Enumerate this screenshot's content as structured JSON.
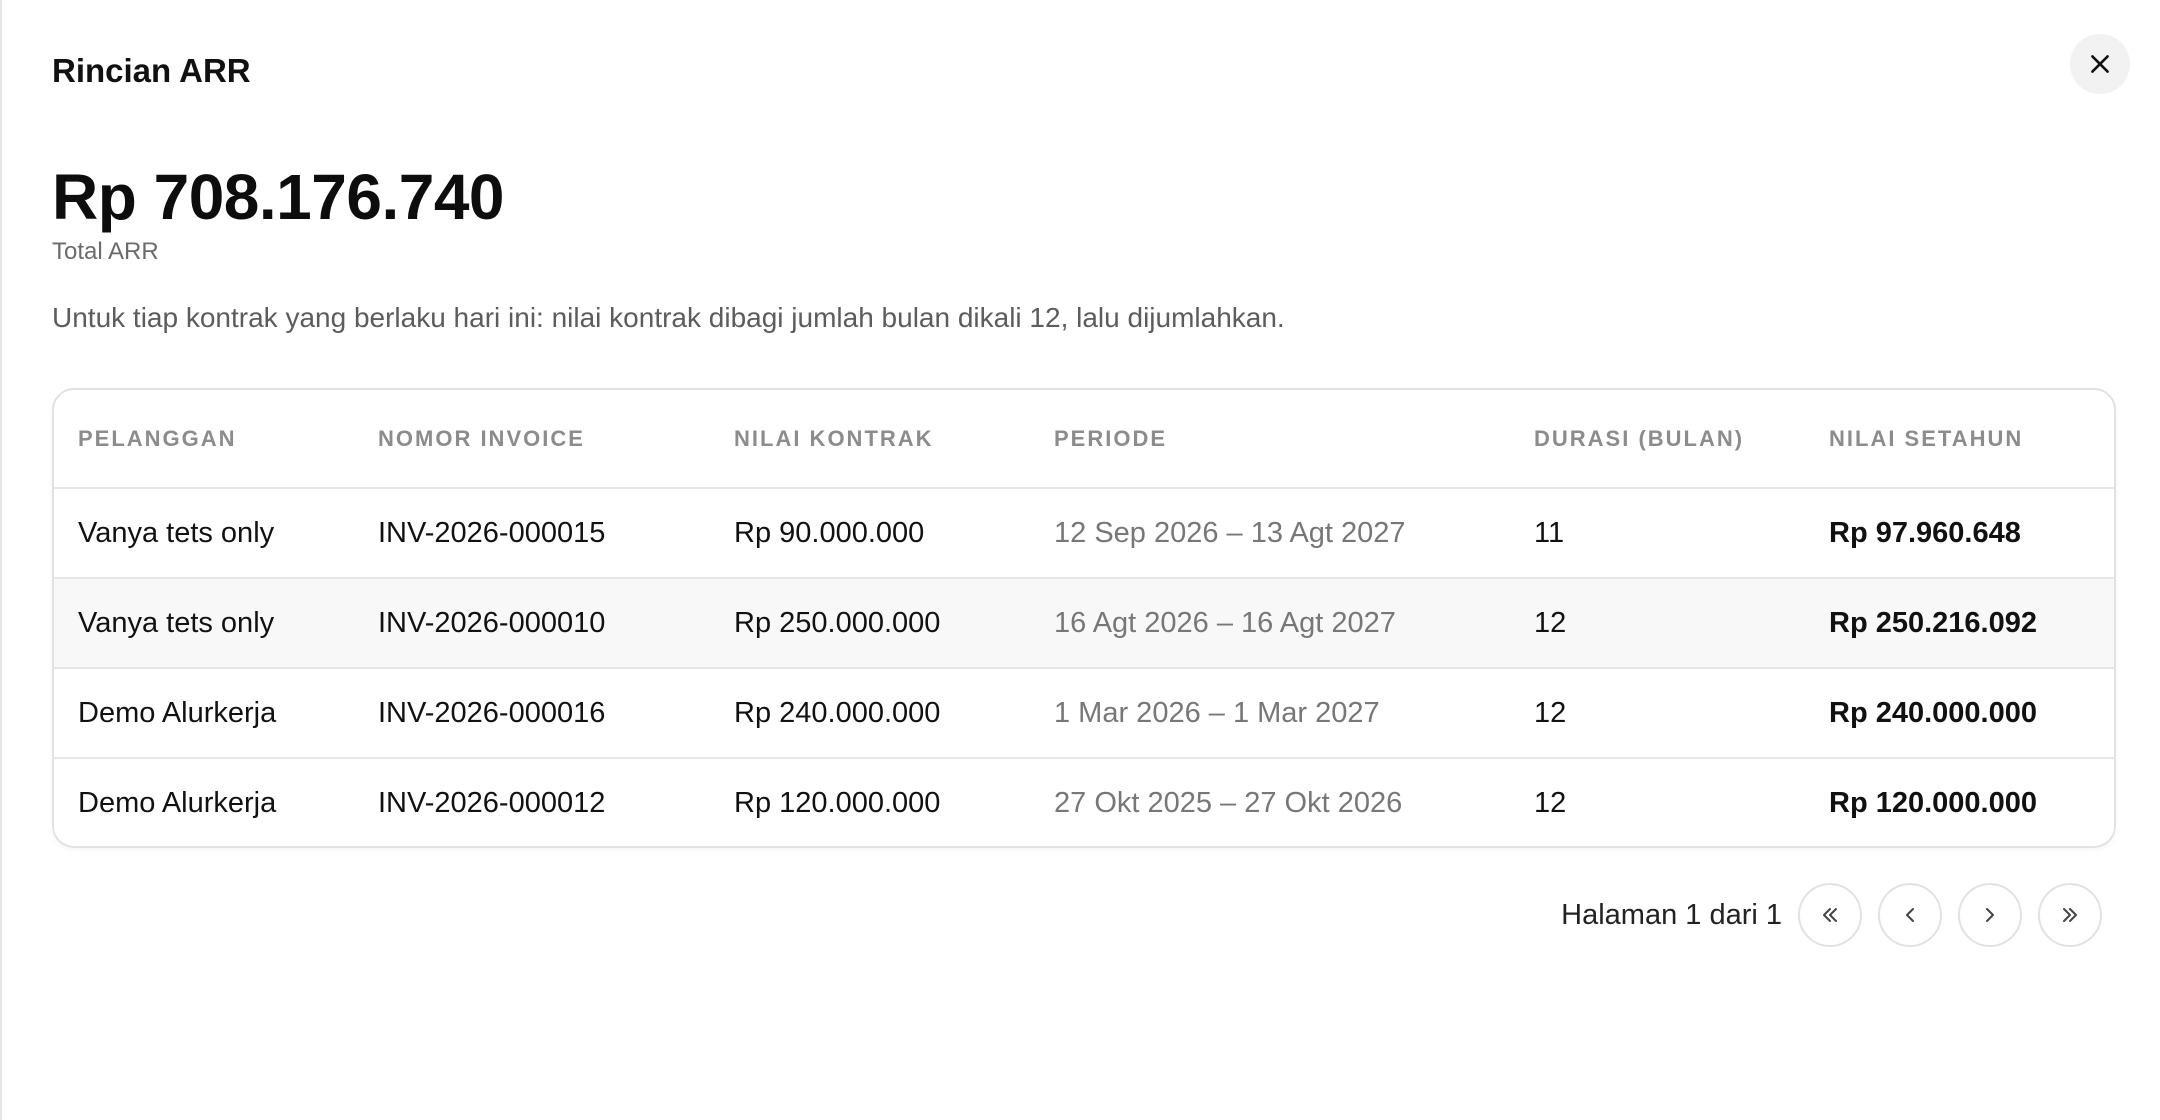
{
  "modal": {
    "title": "Rincian ARR",
    "total_value": "Rp 708.176.740",
    "total_label": "Total ARR",
    "description": "Untuk tiap kontrak yang berlaku hari ini: nilai kontrak dibagi jumlah bulan dikali 12, lalu dijumlahkan."
  },
  "table": {
    "headers": [
      "PELANGGAN",
      "NOMOR INVOICE",
      "NILAI KONTRAK",
      "PERIODE",
      "DURASI (BULAN)",
      "NILAI SETAHUN"
    ],
    "rows": [
      {
        "customer": "Vanya tets only",
        "invoice": "INV-2026-000015",
        "contract_value": "Rp 90.000.000",
        "period": "12 Sep 2026 – 13 Agt 2027",
        "duration": "11",
        "annual_value": "Rp 97.960.648"
      },
      {
        "customer": "Vanya tets only",
        "invoice": "INV-2026-000010",
        "contract_value": "Rp 250.000.000",
        "period": "16 Agt 2026 – 16 Agt 2027",
        "duration": "12",
        "annual_value": "Rp 250.216.092"
      },
      {
        "customer": "Demo Alurkerja",
        "invoice": "INV-2026-000016",
        "contract_value": "Rp 240.000.000",
        "period": "1 Mar 2026 – 1 Mar 2027",
        "duration": "12",
        "annual_value": "Rp 240.000.000"
      },
      {
        "customer": "Demo Alurkerja",
        "invoice": "INV-2026-000012",
        "contract_value": "Rp 120.000.000",
        "period": "27 Okt 2025 – 27 Okt 2026",
        "duration": "12",
        "annual_value": "Rp 120.000.000"
      }
    ]
  },
  "pagination": {
    "label": "Halaman 1 dari 1"
  },
  "icons": {
    "close": "close-icon",
    "first": "chevrons-left-icon",
    "prev": "chevron-left-icon",
    "next": "chevron-right-icon",
    "last": "chevrons-right-icon"
  }
}
